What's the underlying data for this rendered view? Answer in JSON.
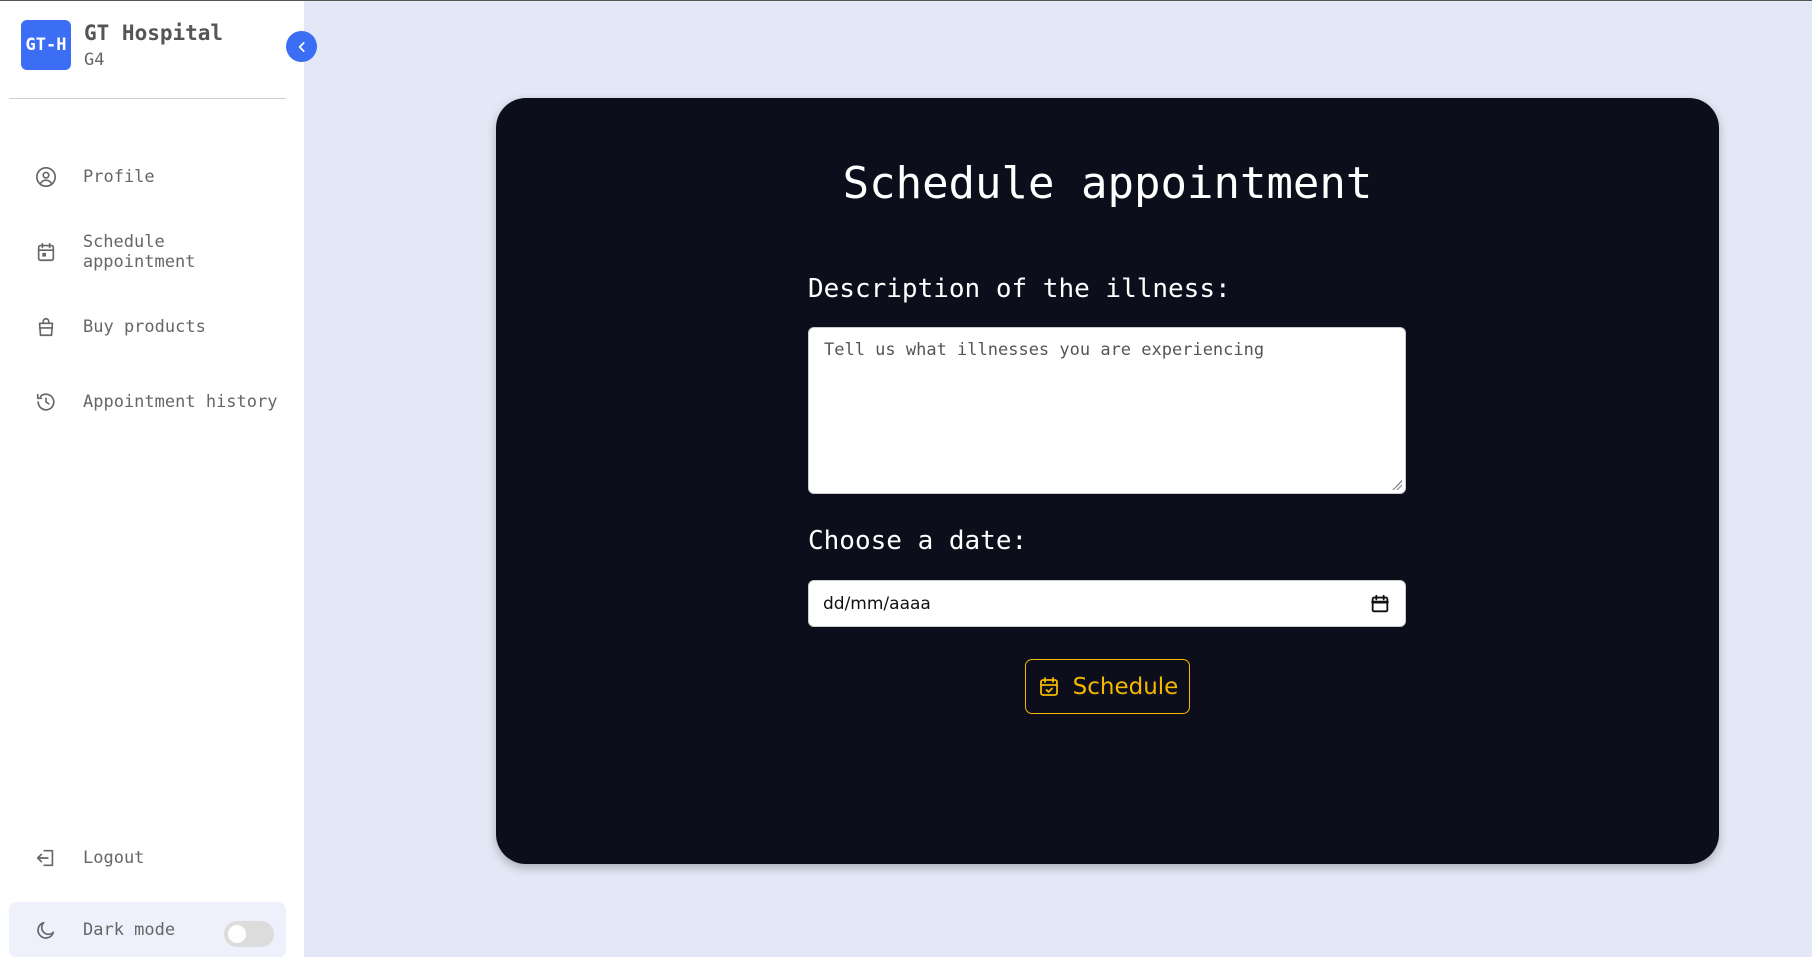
{
  "brand": {
    "logo_text": "GT-H",
    "name": "GT Hospital",
    "subtitle": "G4",
    "accent_color": "#3b6df5"
  },
  "sidebar": {
    "items": [
      {
        "label": "Profile",
        "icon": "user-circle-icon"
      },
      {
        "label": "Schedule appointment",
        "icon": "calendar-icon"
      },
      {
        "label": "Buy products",
        "icon": "shopping-bag-icon"
      },
      {
        "label": "Appointment history",
        "icon": "history-icon"
      }
    ],
    "logout_label": "Logout",
    "dark_mode_label": "Dark mode",
    "dark_mode_on": false
  },
  "form": {
    "title": "Schedule appointment",
    "description_label": "Description of the illness:",
    "description_placeholder": "Tell us what illnesses you are experiencing",
    "date_label": "Choose a date:",
    "date_placeholder": "dd/mm/aaaa",
    "submit_label": "Schedule",
    "submit_color": "#f5b800",
    "card_color": "#0d0e1b"
  }
}
